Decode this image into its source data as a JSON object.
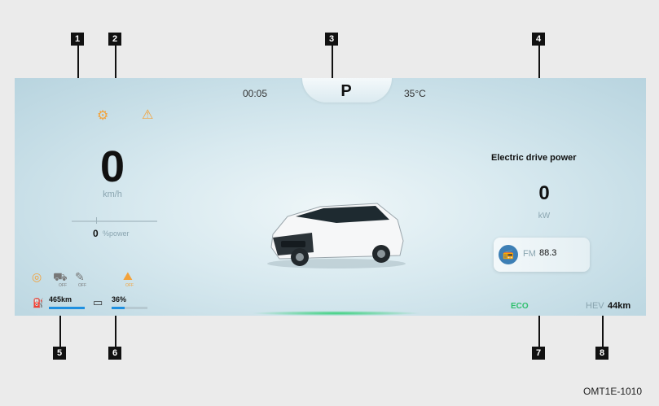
{
  "top_bar": {
    "time": "00:05",
    "gear": "P",
    "temperature": "35°C"
  },
  "speed": {
    "value": "0",
    "unit": "km/h"
  },
  "power": {
    "value": "0",
    "unit": "%power"
  },
  "electric_drive": {
    "title": "Electric drive power",
    "value": "0",
    "unit": "kW"
  },
  "media": {
    "source": "FM",
    "frequency": "88.3"
  },
  "mode": {
    "eco": "ECO"
  },
  "hev": {
    "label": "HEV",
    "range": "44km"
  },
  "fuel": {
    "range": "465km"
  },
  "battery": {
    "level": "36%",
    "level_fraction": 0.36
  },
  "status_icons": {
    "off_label": "OFF"
  },
  "callouts": [
    "1",
    "2",
    "3",
    "4",
    "5",
    "6",
    "7",
    "8"
  ],
  "figure_code": "OMT1E-1010",
  "colors": {
    "accent_orange": "#f3a23a",
    "eco_green": "#2fbf6d",
    "bar_blue": "#1e90e0"
  }
}
